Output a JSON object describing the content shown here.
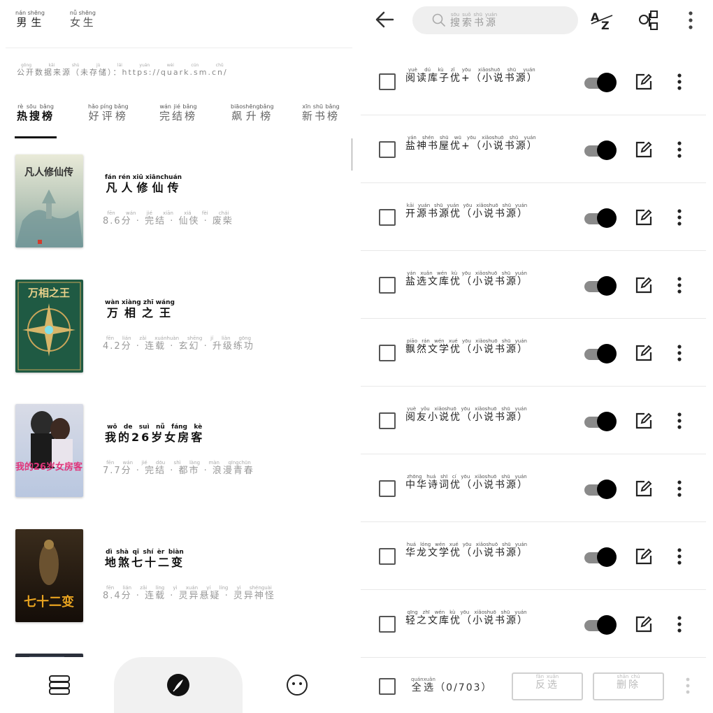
{
  "left": {
    "gender_tabs": [
      {
        "label": "男生",
        "pinyin": "nán shēng"
      },
      {
        "label": "女生",
        "pinyin": "nǚ shēng"
      }
    ],
    "source_note": {
      "text": "公开数据来源（未存储）：https://quark.sm.cn/",
      "pinyin": "gōng kāi shù jù lái yuán  wèi cún chǔ"
    },
    "rank_tabs": [
      {
        "label": "热搜榜",
        "pinyin": "rè sōu bǎng"
      },
      {
        "label": "好评榜",
        "pinyin": "hǎo píng bǎng"
      },
      {
        "label": "完结榜",
        "pinyin": "wán jié bǎng"
      },
      {
        "label": "飙升榜",
        "pinyin": "biāoshēngbǎng"
      },
      {
        "label": "新书榜",
        "pinyin": "xīn shū bǎng"
      }
    ],
    "books": [
      {
        "title": "凡人修仙传",
        "title_pinyin": "fán rén xiū xiānchuán",
        "meta": "8.6分 · 完结 · 仙侠 · 废柴",
        "meta_pinyin": "fēn  wán jié  xiān xiá  fèi chái"
      },
      {
        "title": "万相之王",
        "title_pinyin": "wàn xiàng zhī wáng",
        "meta": "4.2分 · 连载 · 玄幻 · 升级练功",
        "meta_pinyin": "fēn  lián zǎi  xuánhuàn  shēng jí liàn gōng"
      },
      {
        "title": "我的26岁女房客",
        "title_pinyin": "wǒ de  suì nǚ fáng kè",
        "meta": "7.7分 · 完结 · 都市 · 浪漫青春",
        "meta_pinyin": "fēn  wán jié  dōu shì  làng màn qīngchūn"
      },
      {
        "title": "地煞七十二变",
        "title_pinyin": "dì shà qī shí èr biàn",
        "meta": "8.4分 · 连载 · 灵异悬疑 · 灵异神怪",
        "meta_pinyin": "fēn  lián zǎi  líng yì xuán yí  líng yì shénguài"
      }
    ],
    "cover_texts": [
      "凡人修仙传",
      "万相之王",
      "我的26岁女房客",
      "七十二变"
    ]
  },
  "right": {
    "search": {
      "placeholder": "搜索书源",
      "pinyin": "sōu suǒ shū yuán"
    },
    "sources": [
      {
        "name": "阅读库子优+（小说书源）",
        "pinyin": "yuè dú kù zǐ yōu  xiǎoshuō shū yuán"
      },
      {
        "name": "盐神书屋优+（小说书源）",
        "pinyin": "yán shén shū wū yōu  xiǎoshuō shū yuán"
      },
      {
        "name": "开源书源优（小说书源）",
        "pinyin": "kāi yuán shū yuán yōu  xiǎoshuō shū yuán"
      },
      {
        "name": "盐选文库优（小说书源）",
        "pinyin": "yán xuǎn wén kù yōu  xiǎoshuō shū yuán"
      },
      {
        "name": "飘然文学优（小说书源）",
        "pinyin": "piāo rán wén xué yōu  xiǎoshuō shū yuán"
      },
      {
        "name": "阅友小说优（小说书源）",
        "pinyin": "yuè yǒu xiǎoshuō yōu  xiǎoshuō shū yuán"
      },
      {
        "name": "中华诗词优（小说书源）",
        "pinyin": "zhōng huá shī cí yōu  xiǎoshuō shū yuán"
      },
      {
        "name": "华龙文学优（小说书源）",
        "pinyin": "huá lóng wén xué yōu  xiǎoshuō shū yuán"
      },
      {
        "name": "轻之文库优（小说书源）",
        "pinyin": "qīng zhī wén kù yōu  xiǎoshuō shū yuán"
      }
    ],
    "bottom": {
      "select_all": "全选",
      "select_all_pinyin": "quánxuǎn",
      "count": "（0/703）",
      "invert": "反选",
      "invert_pinyin": "fǎn xuǎn",
      "delete": "删除",
      "delete_pinyin": "shān chú"
    }
  },
  "colors": {
    "accent": "#000000",
    "toggle_track": "#8a8a8a",
    "muted_text": "#999999"
  }
}
